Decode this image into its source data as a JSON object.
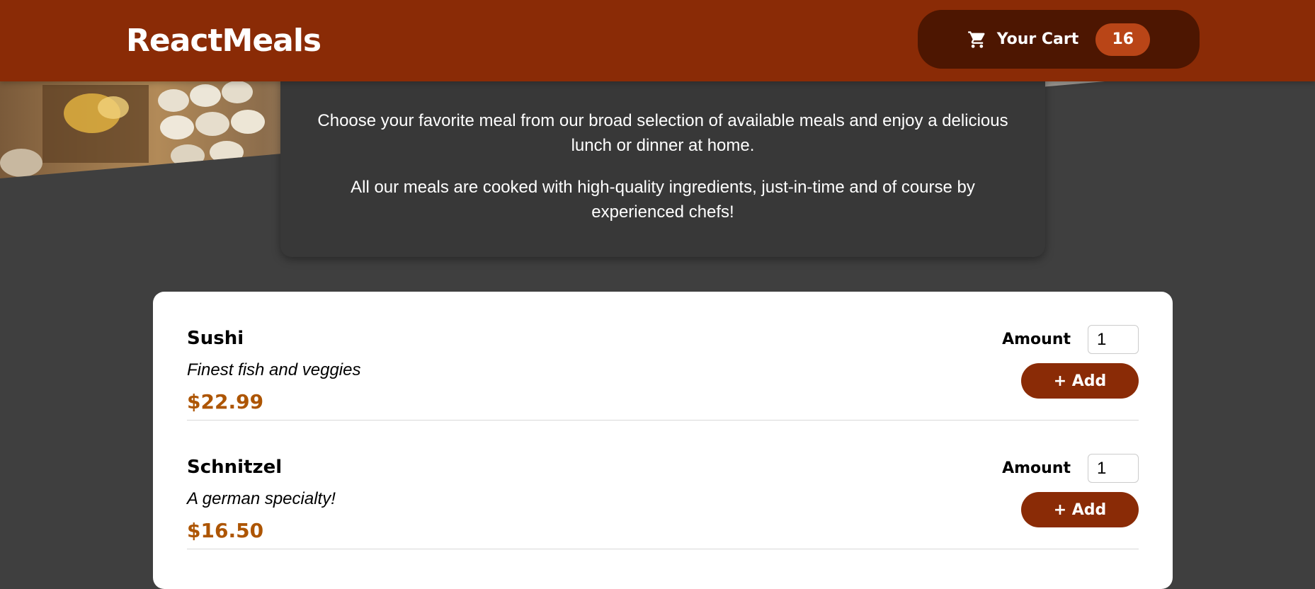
{
  "header": {
    "logo": "ReactMeals",
    "cart": {
      "label": "Your Cart",
      "count": "16",
      "icon": "cart-icon"
    }
  },
  "summary": {
    "paragraphs": [
      "Choose your favorite meal from our broad selection of available meals and enjoy a delicious lunch or dinner at home.",
      "All our meals are cooked with high-quality ingredients, just-in-time and of course by experienced chefs!"
    ]
  },
  "meals": [
    {
      "name": "Sushi",
      "description": "Finest fish and veggies",
      "price": "$22.99",
      "amount_label": "Amount",
      "amount_value": "1",
      "add_label": "+ Add"
    },
    {
      "name": "Schnitzel",
      "description": "A german specialty!",
      "price": "$16.50",
      "amount_label": "Amount",
      "amount_value": "1",
      "add_label": "+ Add"
    }
  ],
  "colors": {
    "header_bg": "#8a2b06",
    "cart_bg": "#4d1601",
    "badge_bg": "#b94517",
    "price": "#ad5502",
    "page_bg": "#3f3f3f",
    "summary_bg": "#383838"
  }
}
